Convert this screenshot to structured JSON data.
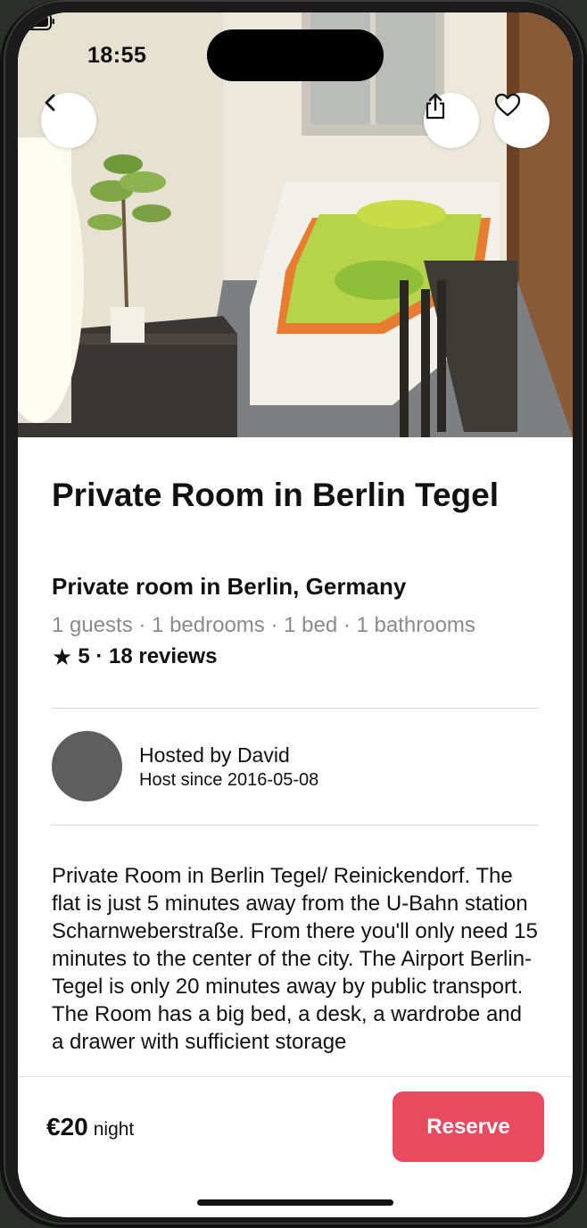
{
  "status_bar": {
    "time": "18:55"
  },
  "hero": {
    "back_icon": "chevron-left-icon",
    "share_icon": "share-icon",
    "favorite_icon": "heart-icon"
  },
  "listing": {
    "title": "Private Room in Berlin Tegel",
    "subtitle": "Private room in Berlin, Germany",
    "meta": "1 guests · 1 bedrooms · 1 bed · 1 bathrooms",
    "rating_icon": "star-icon",
    "rating": "5 · 18 reviews"
  },
  "host": {
    "name": "Hosted by David",
    "since": "Host since 2016-05-08"
  },
  "description": "Private Room in Berlin Tegel/ Reinickendorf. The flat is just 5 minutes away from the U-Bahn station Scharnweberstraße. From there you'll only need 15 minutes to the center of the city. The Airport Berlin-Tegel is only 20 minutes away by public transport. The Room has a big bed, a desk, a wardrobe and a drawer with sufficient storage",
  "footer": {
    "price": "€20",
    "price_unit": "night",
    "reserve_label": "Reserve"
  },
  "colors": {
    "accent": "#e84a5f",
    "avatar": "#5e5e5e"
  }
}
